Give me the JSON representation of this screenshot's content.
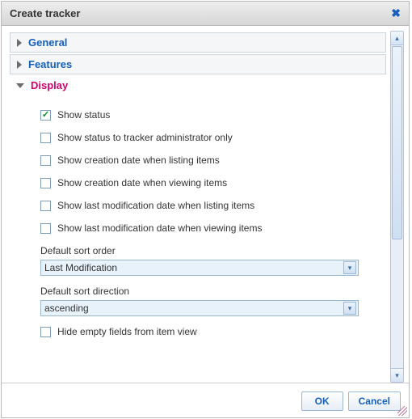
{
  "dialog": {
    "title": "Create tracker",
    "close_glyph": "✖"
  },
  "sections": {
    "general": {
      "label": "General"
    },
    "features": {
      "label": "Features"
    },
    "display": {
      "label": "Display"
    }
  },
  "display": {
    "checkboxes": [
      {
        "label": "Show status",
        "checked": true
      },
      {
        "label": "Show status to tracker administrator only",
        "checked": false
      },
      {
        "label": "Show creation date when listing items",
        "checked": false
      },
      {
        "label": "Show creation date when viewing items",
        "checked": false
      },
      {
        "label": "Show last modification date when listing items",
        "checked": false
      },
      {
        "label": "Show last modification date when viewing items",
        "checked": false
      }
    ],
    "default_sort_order": {
      "label": "Default sort order",
      "value": "Last Modification"
    },
    "default_sort_direction": {
      "label": "Default sort direction",
      "value": "ascending"
    },
    "hide_empty": {
      "label": "Hide empty fields from item view",
      "checked": false
    }
  },
  "footer": {
    "ok": "OK",
    "cancel": "Cancel"
  },
  "glyphs": {
    "check": "✓",
    "dropdown": "▾",
    "up": "▴",
    "down": "▾"
  }
}
